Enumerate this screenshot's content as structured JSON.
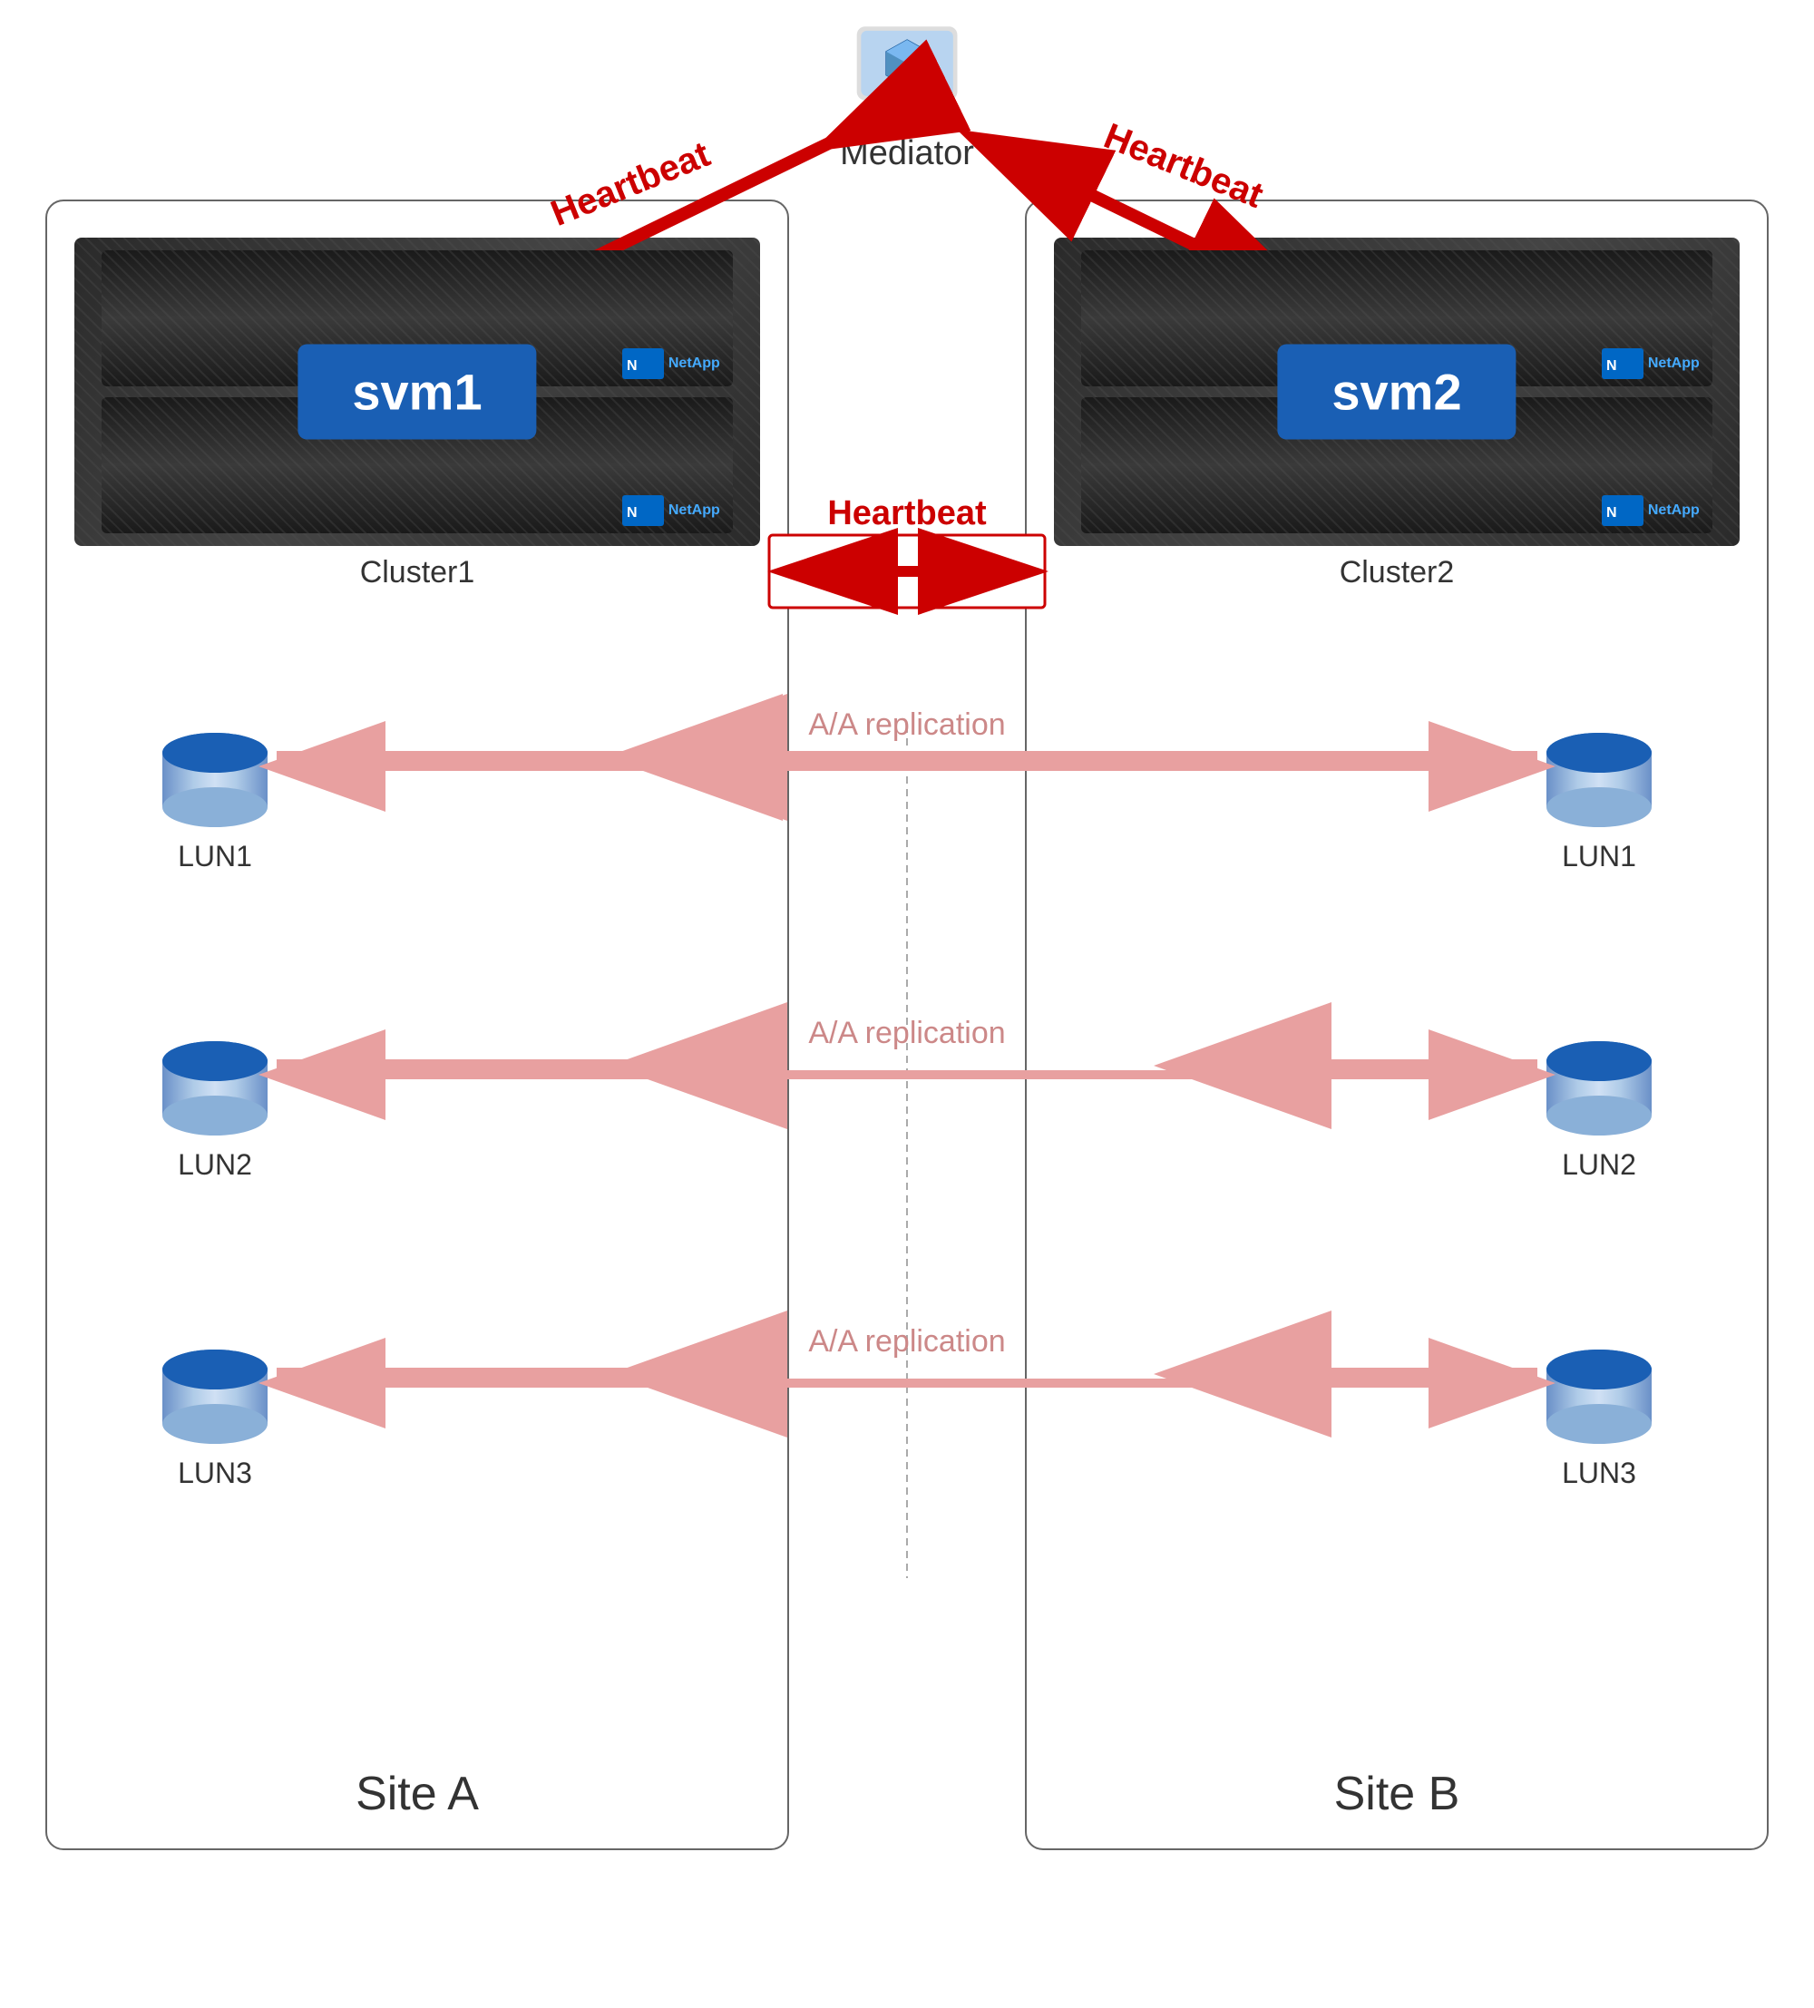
{
  "mediator": {
    "label": "Mediator"
  },
  "heartbeat_labels": {
    "left": "Heartbeat",
    "right": "Heartbeat",
    "center": "Heartbeat"
  },
  "site_a": {
    "label": "Site A",
    "cluster_label": "Cluster1",
    "svm": "svm1",
    "luns": [
      "LUN1",
      "LUN2",
      "LUN3"
    ]
  },
  "site_b": {
    "label": "Site B",
    "cluster_label": "Cluster2",
    "svm": "svm2",
    "luns": [
      "LUN1",
      "LUN2",
      "LUN3"
    ]
  },
  "replication_label": "A/A replication",
  "colors": {
    "red_arrow": "#cc0000",
    "pink_arrow": "#e8a0a0",
    "blue_svm": "#1a5fb4",
    "border": "#666666"
  }
}
